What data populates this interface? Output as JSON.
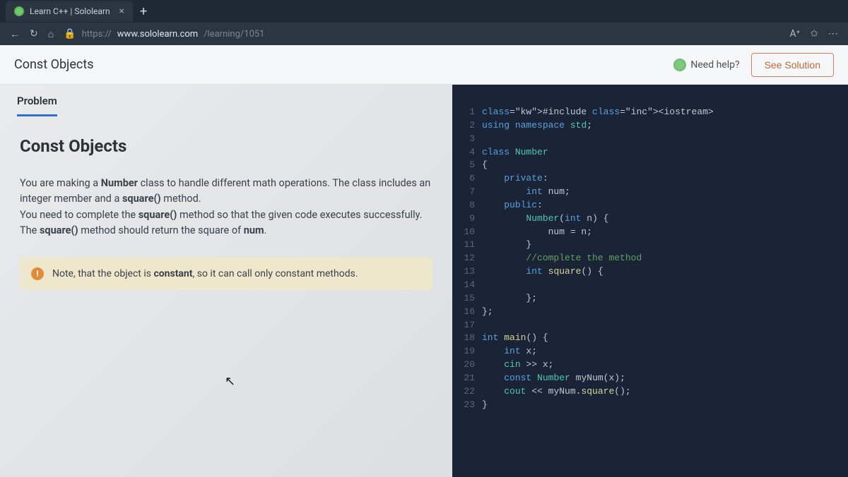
{
  "browser": {
    "tab_title": "Learn C++ | Sololearn",
    "url_prefix": "https://",
    "url_domain": "www.sololearn.com",
    "url_path": "/learning/1051"
  },
  "header": {
    "title": "Const Objects",
    "need_help": "Need help?",
    "see_solution": "See Solution"
  },
  "problem": {
    "tab_label": "Problem",
    "heading": "Const Objects",
    "p1_a": "You are making a ",
    "p1_b": "Number",
    "p1_c": " class to handle different math operations. The class includes an integer member and a ",
    "p1_d": "square()",
    "p1_e": " method.",
    "p2_a": "You need to complete the ",
    "p2_b": "square()",
    "p2_c": " method so that the given code executes successfully.",
    "p3_a": "The ",
    "p3_b": "square()",
    "p3_c": " method should return the square of ",
    "p3_d": "num",
    "p3_e": ".",
    "note_a": "Note, that the object is ",
    "note_b": "constant",
    "note_c": ", so it can call only constant methods."
  },
  "code": {
    "lines": [
      "#include <iostream>",
      "using namespace std;",
      "",
      "class Number",
      "{",
      "    private:",
      "        int num;",
      "    public:",
      "        Number(int n) {",
      "            num = n;",
      "        }",
      "        //complete the method",
      "        int square() {",
      "",
      "        };",
      "};",
      "",
      "int main() {",
      "    int x;",
      "    cin >> x;",
      "    const Number myNum(x);",
      "    cout << myNum.square();",
      "}"
    ]
  }
}
